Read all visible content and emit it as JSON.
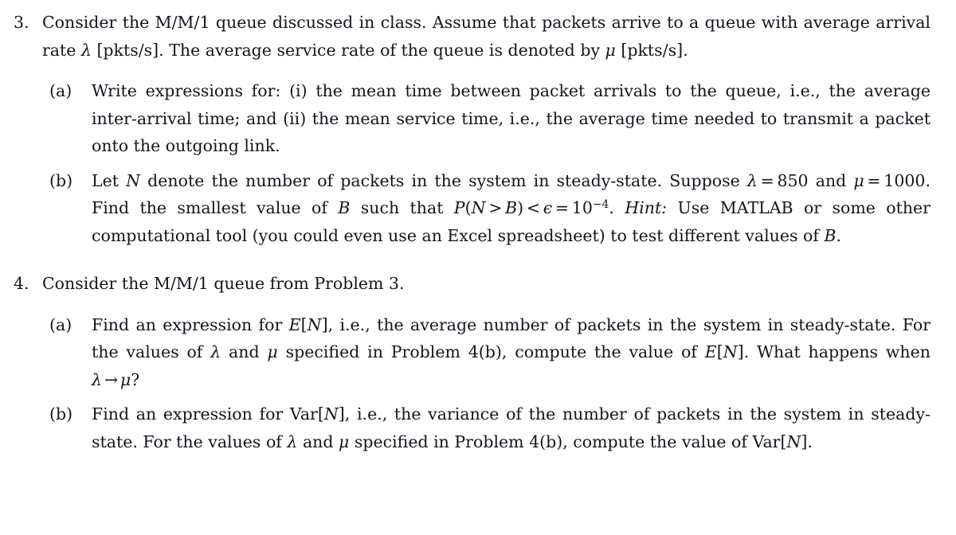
{
  "document": {
    "kind": "homework-problem-set",
    "text_color": "#15151f",
    "background_color": "#ffffff"
  },
  "problems": [
    {
      "marker": "3.",
      "intro": {
        "seg_1": "Consider the M/M/1 queue discussed in class.  Assume that packets arrive to a queue with average arrival rate ",
        "lambda": "λ",
        "seg_2": " [pkts/s].  The average service rate of the queue is denoted by ",
        "mu": "μ",
        "seg_3": " [pkts/s]."
      },
      "subitems": [
        {
          "marker": "(a)",
          "text": "Write expressions for: (i) the mean time between packet arrivals to the queue, i.e., the average inter-arrival time; and (ii) the mean service time, i.e., the average time needed to transmit a packet onto the outgoing link."
        },
        {
          "marker": "(b)",
          "seg_1": "Let ",
          "var_N": "N",
          "seg_2": " denote the number of packets in the system in steady-state.  Suppose ",
          "lambda": "λ",
          "eq_1": "=",
          "lambda_value": "850",
          "seg_3": " and ",
          "mu": "μ",
          "eq_2": "=",
          "mu_value": "1000",
          "seg_4": ".  Find the smallest value of ",
          "var_B_1": "B",
          "seg_5": " such that ",
          "prob_P": "P",
          "prob_open": "(",
          "prob_N": "N",
          "prob_gt": ">",
          "prob_B": "B",
          "prob_close": ")",
          "lt": "<",
          "epsilon": "ϵ",
          "eq_3": "=",
          "base": "10",
          "exponent": "−4",
          "seg_6": ".  ",
          "hint_label": "Hint:",
          "seg_7": " Use MATLAB or some other computational tool (you could even use an Excel spreadsheet) to test different values of ",
          "var_B_2": "B",
          "seg_8": "."
        }
      ]
    },
    {
      "marker": "4.",
      "intro": {
        "seg_1": "Consider the M/M/1 queue from Problem 3."
      },
      "subitems": [
        {
          "marker": "(a)",
          "seg_1": "Find an expression for ",
          "expr_E": "E",
          "expr_open": "[",
          "expr_N": "N",
          "expr_close": "]",
          "seg_2": ", i.e., the average number of packets in the system in steady-state.  For the values of ",
          "lambda": "λ",
          "seg_3": " and ",
          "mu": "μ",
          "seg_4": " specified in Problem 4(b), compute the value of ",
          "expr2_E": "E",
          "expr2_open": "[",
          "expr2_N": "N",
          "expr2_close": "]",
          "seg_5": ".  What happens when ",
          "lambda_2": "λ",
          "arrow": "→",
          "mu_2": "μ",
          "seg_6": "?"
        },
        {
          "marker": "(b)",
          "seg_1": "Find an expression for ",
          "var_label": "Var",
          "expr_open": "[",
          "expr_N": "N",
          "expr_close": "]",
          "seg_2": ", i.e., the variance of the number of packets in the system in steady-state.  For the values of ",
          "lambda": "λ",
          "seg_3": " and ",
          "mu": "μ",
          "seg_4": " specified in Problem 4(b), compute the value of ",
          "var_label_2": "Var",
          "expr2_open": "[",
          "expr2_N": "N",
          "expr2_close": "]",
          "seg_5": "."
        }
      ]
    }
  ]
}
